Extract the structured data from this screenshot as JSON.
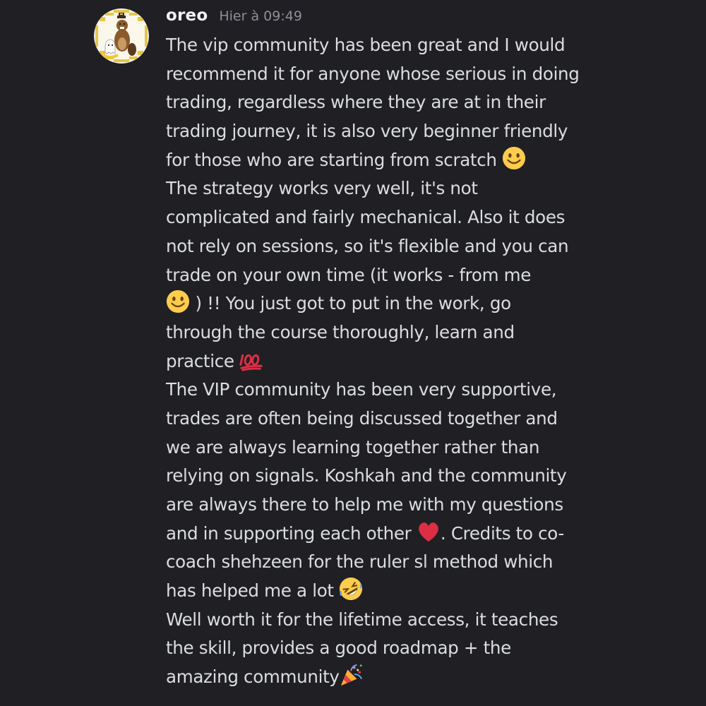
{
  "message": {
    "author": "oreo",
    "timestamp": "Hier à 09:49",
    "avatar_icon": "pixel-beaver-avatar-icon",
    "lines": [
      {
        "text": "The vip community has been great and I would"
      },
      {
        "text": "recommend it for anyone whose serious in doing"
      },
      {
        "text": "trading, regardless where they are at in their"
      },
      {
        "text": "trading journey, it is also very beginner friendly"
      },
      {
        "text": "for those who are starting from scratch ",
        "emoji_after": "slight-smile"
      },
      {
        "text": "The strategy works very well, it's not"
      },
      {
        "text": "complicated and fairly mechanical. Also it does"
      },
      {
        "text": "not rely on sessions, so it's flexible and you can"
      },
      {
        "text": "trade on your own time (it works - from me"
      },
      {
        "emoji_before": "slight-smile",
        "text": " ) !! You just got to put in the work, go"
      },
      {
        "text": "through the course thoroughly, learn and"
      },
      {
        "text": "practice ",
        "emoji_after": "hundred-points"
      },
      {
        "text": "The VIP community has been very supportive,"
      },
      {
        "text": "trades are often being discussed together and"
      },
      {
        "text": "we are always learning together rather than"
      },
      {
        "text": "relying on signals. Koshkah and the community"
      },
      {
        "text": "are always there to help me with my questions"
      },
      {
        "text": "and in supporting each other ",
        "emoji_after": "red-heart",
        "text_after": ". Credits to co-"
      },
      {
        "text": "coach shehzeen for the ruler sl method which"
      },
      {
        "text": "has helped me a lot ",
        "emoji_after": "rolling-on-floor-laughing"
      },
      {
        "text": "Well worth it for the lifetime access, it teaches"
      },
      {
        "text": "the skill, provides a good roadmap + the"
      },
      {
        "text": "amazing community",
        "emoji_after": "party-popper"
      }
    ]
  },
  "colors": {
    "background": "#1f1f24",
    "username": "#f2f3f5",
    "timestamp": "#8e9097",
    "text": "#dbdee1"
  }
}
